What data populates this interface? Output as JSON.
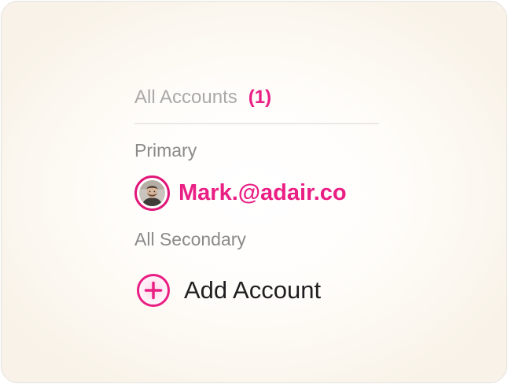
{
  "accounts": {
    "header_title": "All Accounts",
    "header_count": "(1)",
    "primary_label": "Primary",
    "primary_account": {
      "email": "Mark.@adair.co",
      "avatar_icon": "user-avatar-photo"
    },
    "secondary_label": "All Secondary",
    "add_account_label": "Add Account",
    "add_account_icon": "plus-circle-icon"
  },
  "colors": {
    "accent": "#ea1f84",
    "muted_text": "#8a8a8a",
    "header_text": "#a9a9a9",
    "primary_text": "#1f1f1f"
  }
}
